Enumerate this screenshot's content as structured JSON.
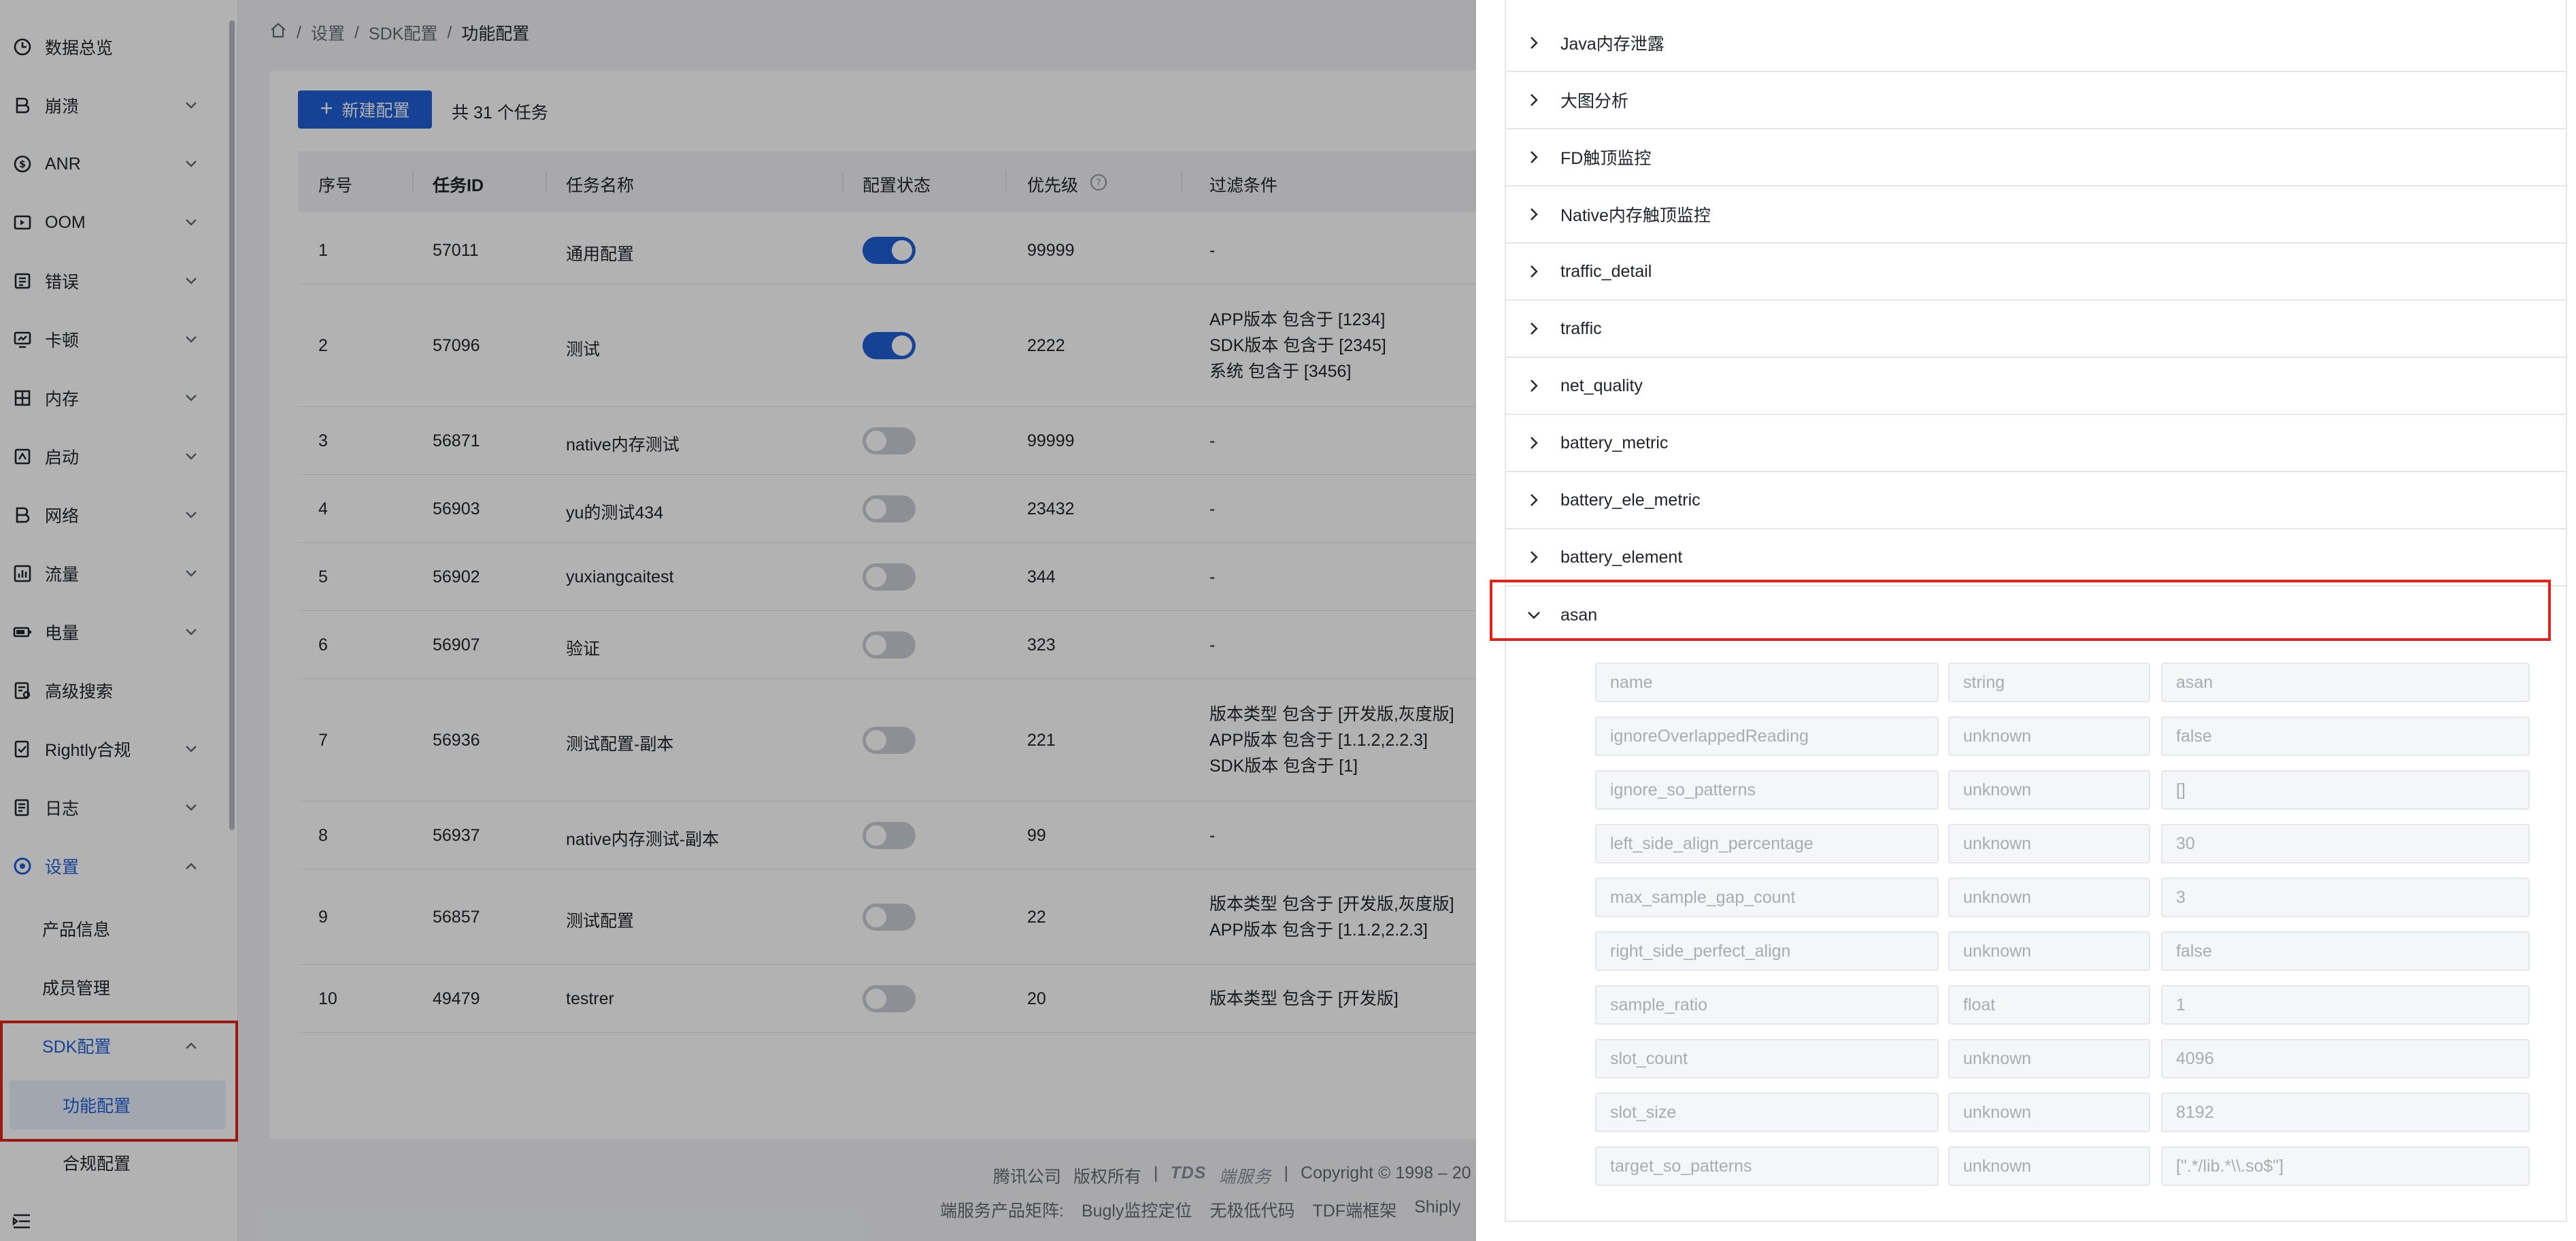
{
  "breadcrumb": {
    "items": [
      "设置",
      "SDK配置"
    ],
    "current": "功能配置",
    "separator": "/"
  },
  "sidebar": {
    "items": [
      {
        "label": "数据总览",
        "icon": "clock-icon",
        "chevron": false
      },
      {
        "label": "崩溃",
        "icon": "crash-icon",
        "chevron": true
      },
      {
        "label": "ANR",
        "icon": "anr-icon",
        "chevron": true
      },
      {
        "label": "OOM",
        "icon": "oom-icon",
        "chevron": true
      },
      {
        "label": "错误",
        "icon": "error-icon",
        "chevron": true
      },
      {
        "label": "卡顿",
        "icon": "lag-icon",
        "chevron": true
      },
      {
        "label": "内存",
        "icon": "memory-icon",
        "chevron": true
      },
      {
        "label": "启动",
        "icon": "launch-icon",
        "chevron": true
      },
      {
        "label": "网络",
        "icon": "network-icon",
        "chevron": true
      },
      {
        "label": "流量",
        "icon": "traffic-icon",
        "chevron": true
      },
      {
        "label": "电量",
        "icon": "battery-icon",
        "chevron": true
      },
      {
        "label": "高级搜索",
        "icon": "advanced-search-icon",
        "chevron": false
      },
      {
        "label": "Rightly合规",
        "icon": "compliance-icon",
        "chevron": true
      },
      {
        "label": "日志",
        "icon": "log-icon",
        "chevron": true
      },
      {
        "label": "设置",
        "icon": "settings-icon",
        "chevron": true,
        "active": true,
        "expanded": true
      }
    ],
    "settings_children": [
      "产品信息",
      "成员管理"
    ],
    "sdk_group": {
      "label": "SDK配置",
      "children": [
        "功能配置",
        "合规配置"
      ],
      "selected": "功能配置"
    }
  },
  "toolbar": {
    "new_button": "新建配置",
    "count_text": "共 31 个任务"
  },
  "table": {
    "columns": [
      "序号",
      "任务ID",
      "任务名称",
      "配置状态",
      "优先级",
      "过滤条件"
    ],
    "rows": [
      {
        "no": "1",
        "id": "57011",
        "name": "通用配置",
        "enabled": true,
        "priority": "99999",
        "filters": [
          "-"
        ]
      },
      {
        "no": "2",
        "id": "57096",
        "name": "测试",
        "enabled": true,
        "priority": "2222",
        "filters": [
          "APP版本 包含于 [1234]",
          "SDK版本 包含于 [2345]",
          "系统 包含于 [3456]"
        ]
      },
      {
        "no": "3",
        "id": "56871",
        "name": "native内存测试",
        "enabled": false,
        "priority": "99999",
        "filters": [
          "-"
        ]
      },
      {
        "no": "4",
        "id": "56903",
        "name": "yu的测试434",
        "enabled": false,
        "priority": "23432",
        "filters": [
          "-"
        ]
      },
      {
        "no": "5",
        "id": "56902",
        "name": "yuxiangcaitest",
        "enabled": false,
        "priority": "344",
        "filters": [
          "-"
        ]
      },
      {
        "no": "6",
        "id": "56907",
        "name": "验证",
        "enabled": false,
        "priority": "323",
        "filters": [
          "-"
        ]
      },
      {
        "no": "7",
        "id": "56936",
        "name": "测试配置-副本",
        "enabled": false,
        "priority": "221",
        "filters": [
          "版本类型 包含于 [开发版,灰度版]",
          "APP版本 包含于 [1.1.2,2.2.3]",
          "SDK版本 包含于 [1]"
        ]
      },
      {
        "no": "8",
        "id": "56937",
        "name": "native内存测试-副本",
        "enabled": false,
        "priority": "99",
        "filters": [
          "-"
        ]
      },
      {
        "no": "9",
        "id": "56857",
        "name": "测试配置",
        "enabled": false,
        "priority": "22",
        "filters": [
          "版本类型 包含于 [开发版,灰度版]",
          "APP版本 包含于 [1.1.2,2.2.3]"
        ]
      },
      {
        "no": "10",
        "id": "49479",
        "name": "testrer",
        "enabled": false,
        "priority": "20",
        "filters": [
          "版本类型 包含于 [开发版]"
        ]
      }
    ]
  },
  "footer": {
    "line1": [
      "腾讯公司",
      "版权所有",
      "|",
      "TDS",
      "端服务",
      "|",
      "Copyright © 1998 – 20"
    ],
    "line2": [
      "端服务产品矩阵:",
      "Bugly监控定位",
      "无极低代码",
      "TDF端框架",
      "Shiply"
    ]
  },
  "drawer": {
    "collapsed_items": [
      "Java内存泄露",
      "大图分析",
      "FD触顶监控",
      "Native内存触顶监控",
      "traffic_detail",
      "traffic",
      "net_quality",
      "battery_metric",
      "battery_ele_metric",
      "battery_element"
    ],
    "expanded_item": "asan",
    "fields": [
      {
        "name": "name",
        "type": "string",
        "value": "asan"
      },
      {
        "name": "ignoreOverlappedReading",
        "type": "unknown",
        "value": "false"
      },
      {
        "name": "ignore_so_patterns",
        "type": "unknown",
        "value": "[]"
      },
      {
        "name": "left_side_align_percentage",
        "type": "unknown",
        "value": "30"
      },
      {
        "name": "max_sample_gap_count",
        "type": "unknown",
        "value": "3"
      },
      {
        "name": "right_side_perfect_align",
        "type": "unknown",
        "value": "false"
      },
      {
        "name": "sample_ratio",
        "type": "float",
        "value": "1"
      },
      {
        "name": "slot_count",
        "type": "unknown",
        "value": "4096"
      },
      {
        "name": "slot_size",
        "type": "unknown",
        "value": "8192"
      },
      {
        "name": "target_so_patterns",
        "type": "unknown",
        "value": "[\".*/lib.*\\\\.so$\"]"
      }
    ]
  },
  "colors": {
    "primary": "#1f5fd6",
    "highlight_border": "#e2231a",
    "toggle_off": "#c9cdd4"
  }
}
